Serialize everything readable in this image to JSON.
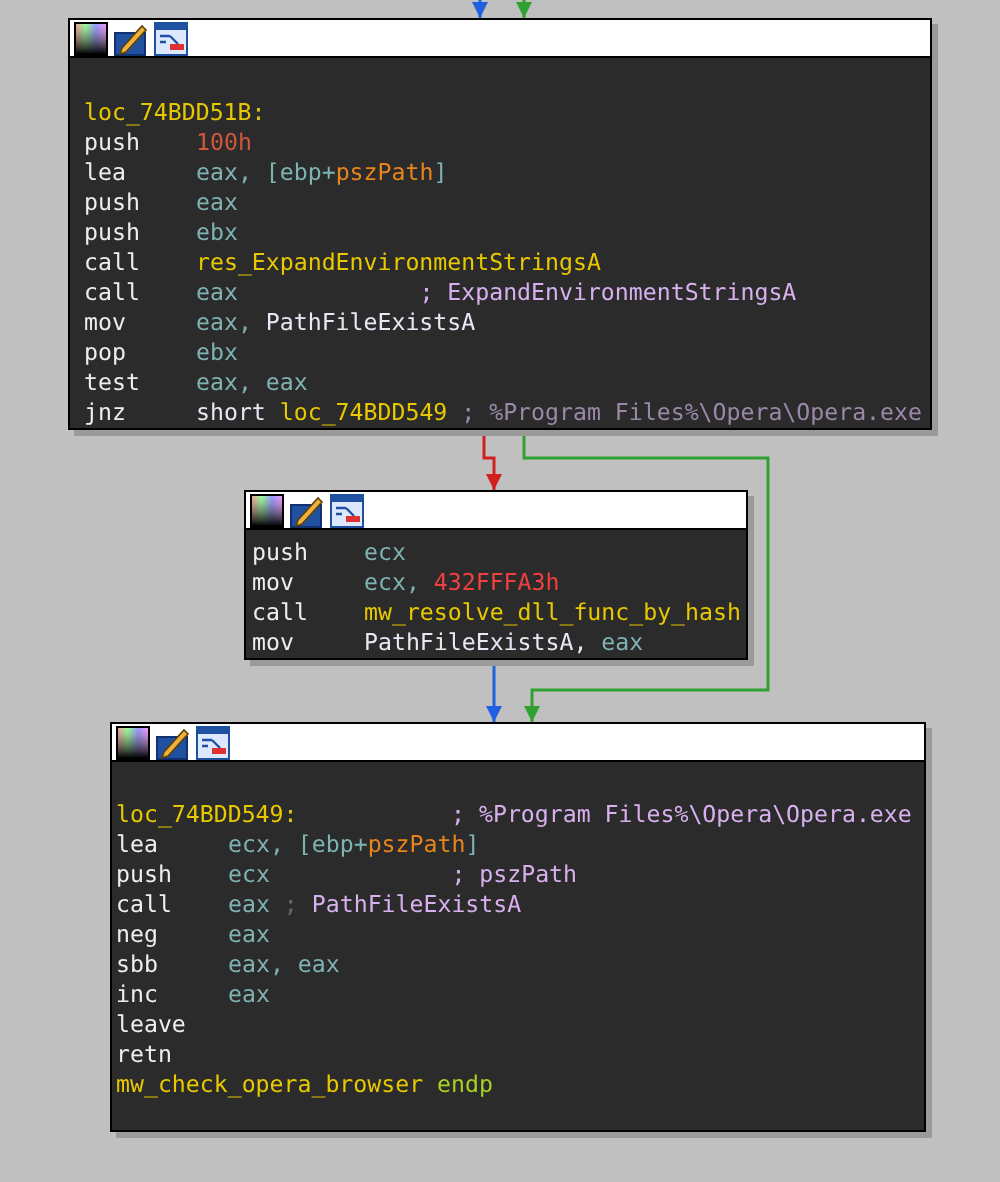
{
  "blocks": [
    {
      "lines": [
        [
          {
            "text": "loc_74BDD51B:",
            "kind": "label"
          }
        ],
        [
          {
            "text": "push",
            "kind": "mnem"
          },
          {
            "text": "100h",
            "kind": "num"
          }
        ],
        [
          {
            "text": "lea",
            "kind": "mnem"
          },
          {
            "text": "eax, [ebp+",
            "kind": "reg"
          },
          {
            "text": "pszPath",
            "kind": "var"
          },
          {
            "text": "]",
            "kind": "reg"
          }
        ],
        [
          {
            "text": "push",
            "kind": "mnem"
          },
          {
            "text": "eax",
            "kind": "reg"
          }
        ],
        [
          {
            "text": "push",
            "kind": "mnem"
          },
          {
            "text": "ebx",
            "kind": "reg"
          }
        ],
        [
          {
            "text": "call",
            "kind": "mnem"
          },
          {
            "text": "res_ExpandEnvironmentStringsA",
            "kind": "name"
          }
        ],
        [
          {
            "text": "call",
            "kind": "mnem"
          },
          {
            "text": "eax",
            "kind": "reg"
          },
          {
            "text": "             ; ExpandEnvironmentStringsA",
            "kind": "comment"
          }
        ],
        [
          {
            "text": "mov",
            "kind": "mnem"
          },
          {
            "text": "eax, ",
            "kind": "reg"
          },
          {
            "text": "PathFileExistsA",
            "kind": "plain"
          }
        ],
        [
          {
            "text": "pop",
            "kind": "mnem"
          },
          {
            "text": "ebx",
            "kind": "reg"
          }
        ],
        [
          {
            "text": "test",
            "kind": "mnem"
          },
          {
            "text": "eax, eax",
            "kind": "reg"
          }
        ],
        [
          {
            "text": "jnz",
            "kind": "mnem"
          },
          {
            "text": "short ",
            "kind": "plain"
          },
          {
            "text": "loc_74BDD549",
            "kind": "name"
          },
          {
            "text": " ; %Program Files%\\Opera\\Opera.exe",
            "kind": "auto"
          }
        ]
      ]
    },
    {
      "lines": [
        [
          {
            "text": "push",
            "kind": "mnem"
          },
          {
            "text": "ecx",
            "kind": "reg"
          }
        ],
        [
          {
            "text": "mov",
            "kind": "mnem"
          },
          {
            "text": "ecx, ",
            "kind": "reg"
          },
          {
            "text": "432FFFA3h",
            "kind": "num2"
          }
        ],
        [
          {
            "text": "call",
            "kind": "mnem"
          },
          {
            "text": "mw_resolve_dll_func_by_hash",
            "kind": "name"
          }
        ],
        [
          {
            "text": "mov",
            "kind": "mnem"
          },
          {
            "text": "PathFileExistsA, ",
            "kind": "plain"
          },
          {
            "text": "eax",
            "kind": "reg"
          }
        ]
      ]
    },
    {
      "lines": [
        [
          {
            "text": "loc_74BDD549:",
            "kind": "label"
          },
          {
            "text": "           ; %Program Files%\\Opera\\Opera.exe",
            "kind": "comment"
          }
        ],
        [
          {
            "text": "lea",
            "kind": "mnem"
          },
          {
            "text": "ecx, [ebp+",
            "kind": "reg"
          },
          {
            "text": "pszPath",
            "kind": "var"
          },
          {
            "text": "]",
            "kind": "reg"
          }
        ],
        [
          {
            "text": "push",
            "kind": "mnem"
          },
          {
            "text": "ecx",
            "kind": "reg"
          },
          {
            "text": "             ; pszPath",
            "kind": "comment"
          }
        ],
        [
          {
            "text": "call",
            "kind": "mnem"
          },
          {
            "text": "eax",
            "kind": "reg"
          },
          {
            "text": " ;",
            "kind": "dim"
          },
          {
            "text": " PathFileExistsA",
            "kind": "comment"
          }
        ],
        [
          {
            "text": "neg",
            "kind": "mnem"
          },
          {
            "text": "eax",
            "kind": "reg"
          }
        ],
        [
          {
            "text": "sbb",
            "kind": "mnem"
          },
          {
            "text": "eax, eax",
            "kind": "reg"
          }
        ],
        [
          {
            "text": "inc",
            "kind": "mnem"
          },
          {
            "text": "eax",
            "kind": "reg"
          }
        ],
        [
          {
            "text": "leave",
            "kind": "mnem"
          }
        ],
        [
          {
            "text": "retn",
            "kind": "mnem"
          }
        ],
        [
          {
            "text": "mw_check_opera_browser",
            "kind": "name"
          },
          {
            "text": " endp",
            "kind": "kw"
          }
        ]
      ]
    }
  ],
  "edges": [
    {
      "kind": "flow"
    },
    {
      "kind": "taken"
    },
    {
      "kind": "not_taken"
    },
    {
      "kind": "taken"
    },
    {
      "kind": "flow"
    }
  ]
}
